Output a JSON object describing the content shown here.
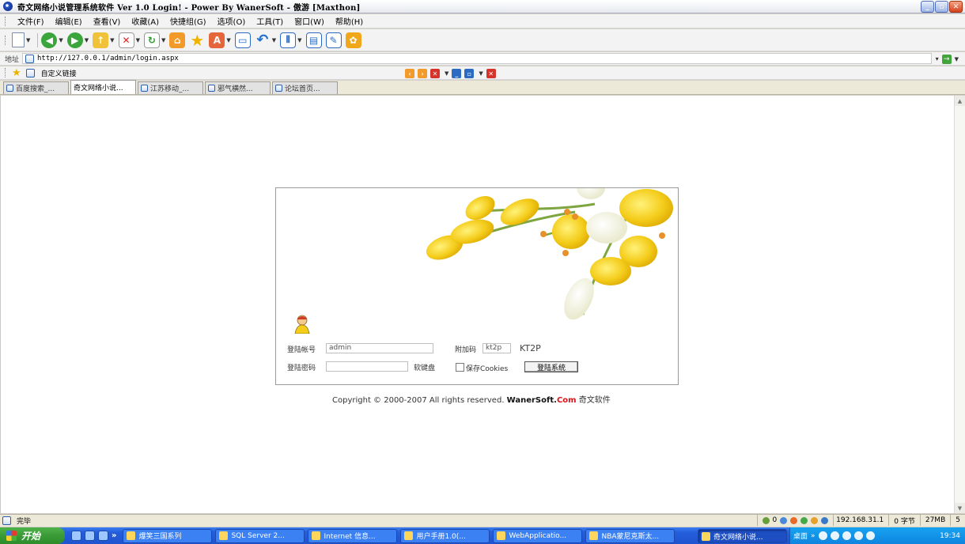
{
  "window": {
    "title": "奇文网络小说管理系统软件 Ver 1.0 Login! - Power By WanerSoft - 傲游 [Maxthon]"
  },
  "menu": [
    {
      "label": "文件(F)"
    },
    {
      "label": "编辑(E)"
    },
    {
      "label": "查看(V)"
    },
    {
      "label": "收藏(A)"
    },
    {
      "label": "快捷组(G)"
    },
    {
      "label": "选项(O)"
    },
    {
      "label": "工具(T)"
    },
    {
      "label": "窗口(W)"
    },
    {
      "label": "帮助(H)"
    }
  ],
  "address": {
    "label": "地址",
    "url": "http://127.0.0.1/admin/login.aspx"
  },
  "links": {
    "label": "自定义链接"
  },
  "tabs": [
    {
      "label": "百度搜索_..."
    },
    {
      "label": "奇文网络小说..."
    },
    {
      "label": "江苏移动_..."
    },
    {
      "label": "邪气横然..."
    },
    {
      "label": "论坛首页..."
    }
  ],
  "login": {
    "account_label": "登陆帐号",
    "account_value": "admin",
    "password_label": "登陆密码",
    "password_value": "",
    "keyboard_label": "软键盘",
    "captcha_label": "附加码",
    "captcha_value": "kt2p",
    "captcha_image_text": "KT2P",
    "remember_label": "保存Cookies",
    "submit_label": "登陆系统"
  },
  "copyright": {
    "prefix": "Copyright © 2000-2007 All rights reserved.",
    "brand_main": "WanerSoft.",
    "brand_suffix": "Com",
    "brand_cn": "奇文软件"
  },
  "status": {
    "text": "完毕",
    "count": "0",
    "ip": "192.168.31.1",
    "bytes": "0 字节",
    "memory": "27MB",
    "extra": "5"
  },
  "taskbar": {
    "start_label": "开始",
    "tasks": [
      {
        "label": "爆笑三国系列"
      },
      {
        "label": "SQL Server 2..."
      },
      {
        "label": "Internet 信息..."
      },
      {
        "label": "用户手册1.0(..."
      },
      {
        "label": "WebApplicatio..."
      },
      {
        "label": "NBA蒙尼克斯太..."
      },
      {
        "label": "奇文网络小说..."
      }
    ],
    "tray_label": "桌面",
    "time": "19:34"
  },
  "colors": {
    "accent_red": "#d4141a",
    "taskbar_blue": "#245edb",
    "start_green": "#3a9b36",
    "flower_yellow": "#f4cc1a"
  }
}
